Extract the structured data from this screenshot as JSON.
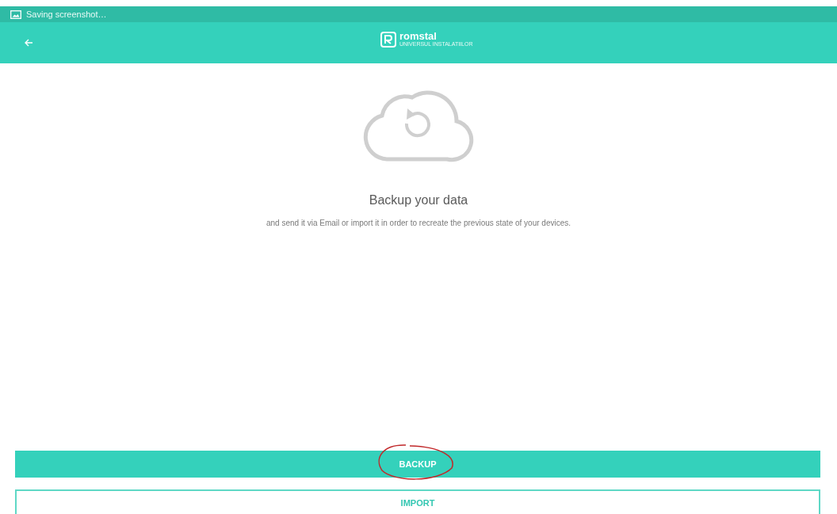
{
  "status_bar": {
    "text": "Saving screenshot…"
  },
  "toolbar": {
    "logo": {
      "name": "romstal",
      "tagline": "UNIVERSUL INSTALATIILOR"
    }
  },
  "content": {
    "title": "Backup your data",
    "description": "and send it via Email or import it in order to recreate the previous state of your devices."
  },
  "buttons": [
    {
      "label": "BACKUP",
      "kind": "filled"
    },
    {
      "label": "IMPORT",
      "kind": "outlined"
    }
  ]
}
